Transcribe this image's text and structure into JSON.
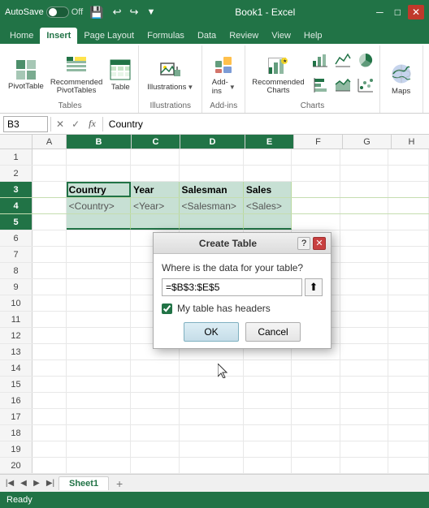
{
  "titleBar": {
    "title": "Book1 - Excel",
    "autoSaveLabel": "AutoSave",
    "autoSaveState": "Off"
  },
  "qat": {
    "buttons": [
      "💾",
      "↩",
      "↪",
      "🖊",
      "▼"
    ]
  },
  "ribbonTabs": [
    "Home",
    "Insert",
    "Page Layout",
    "Formulas",
    "Data",
    "Review",
    "View",
    "Help"
  ],
  "activeTab": "Insert",
  "ribbonGroups": [
    {
      "name": "Tables",
      "items": [
        {
          "id": "pivot-table",
          "icon": "pivot",
          "label": "PivotTable"
        },
        {
          "id": "recommended-pivots",
          "icon": "rec-pivot",
          "label": "Recommended\nPivotTables"
        },
        {
          "id": "table",
          "icon": "table",
          "label": "Table"
        }
      ]
    },
    {
      "name": "Illustrations",
      "items": [
        {
          "id": "illustrations",
          "icon": "illus",
          "label": "Illustrations",
          "hasDropdown": true
        }
      ]
    },
    {
      "name": "Add-ins",
      "items": [
        {
          "id": "add-ins",
          "icon": "addins",
          "label": "Add-\nins",
          "hasDropdown": true
        }
      ]
    },
    {
      "name": "Charts",
      "items": [
        {
          "id": "recommended-charts",
          "icon": "rec-charts",
          "label": "Recommended\nCharts"
        },
        {
          "id": "col-chart",
          "icon": "col",
          "label": ""
        },
        {
          "id": "line-chart",
          "icon": "line",
          "label": ""
        },
        {
          "id": "pie-chart",
          "icon": "pie",
          "label": ""
        },
        {
          "id": "bar-chart",
          "icon": "bar",
          "label": ""
        },
        {
          "id": "area-chart",
          "icon": "area",
          "label": ""
        },
        {
          "id": "scatter-chart",
          "icon": "scatter",
          "label": ""
        },
        {
          "id": "more-charts",
          "icon": "more",
          "label": ""
        }
      ]
    },
    {
      "name": "Maps",
      "items": [
        {
          "id": "maps",
          "icon": "maps",
          "label": "Maps"
        }
      ]
    }
  ],
  "formulaBar": {
    "nameBox": "B3",
    "cancelIcon": "✕",
    "confirmIcon": "✓",
    "functionIcon": "fx",
    "formula": "Country"
  },
  "columns": [
    "A",
    "B",
    "C",
    "D",
    "E",
    "F",
    "G",
    "H"
  ],
  "rows": [
    {
      "num": 1,
      "cells": [
        "",
        "",
        "",
        "",
        "",
        "",
        "",
        ""
      ]
    },
    {
      "num": 2,
      "cells": [
        "",
        "",
        "",
        "",
        "",
        "",
        "",
        ""
      ]
    },
    {
      "num": 3,
      "cells": [
        "",
        "Country",
        "Year",
        "Salesman",
        "Sales",
        "",
        "",
        ""
      ]
    },
    {
      "num": 4,
      "cells": [
        "",
        "<Country>",
        "<Year>",
        "<Salesman>",
        "<Sales>",
        "",
        "",
        ""
      ]
    },
    {
      "num": 5,
      "cells": [
        "",
        "",
        "",
        "",
        "",
        "",
        "",
        ""
      ]
    },
    {
      "num": 6,
      "cells": [
        "",
        "",
        "",
        "",
        "",
        "",
        "",
        ""
      ]
    },
    {
      "num": 7,
      "cells": [
        "",
        "",
        "",
        "",
        "",
        "",
        "",
        ""
      ]
    },
    {
      "num": 8,
      "cells": [
        "",
        "",
        "",
        "",
        "",
        "",
        "",
        ""
      ]
    },
    {
      "num": 9,
      "cells": [
        "",
        "",
        "",
        "",
        "",
        "",
        "",
        ""
      ]
    },
    {
      "num": 10,
      "cells": [
        "",
        "",
        "",
        "",
        "",
        "",
        "",
        ""
      ]
    },
    {
      "num": 11,
      "cells": [
        "",
        "",
        "",
        "",
        "",
        "",
        "",
        ""
      ]
    },
    {
      "num": 12,
      "cells": [
        "",
        "",
        "",
        "",
        "",
        "",
        "",
        ""
      ]
    },
    {
      "num": 13,
      "cells": [
        "",
        "",
        "",
        "",
        "",
        "",
        "",
        ""
      ]
    },
    {
      "num": 14,
      "cells": [
        "",
        "",
        "",
        "",
        "",
        "",
        "",
        ""
      ]
    },
    {
      "num": 15,
      "cells": [
        "",
        "",
        "",
        "",
        "",
        "",
        "",
        ""
      ]
    },
    {
      "num": 16,
      "cells": [
        "",
        "",
        "",
        "",
        "",
        "",
        "",
        ""
      ]
    },
    {
      "num": 17,
      "cells": [
        "",
        "",
        "",
        "",
        "",
        "",
        "",
        ""
      ]
    },
    {
      "num": 18,
      "cells": [
        "",
        "",
        "",
        "",
        "",
        "",
        "",
        ""
      ]
    },
    {
      "num": 19,
      "cells": [
        "",
        "",
        "",
        "",
        "",
        "",
        "",
        ""
      ]
    },
    {
      "num": 20,
      "cells": [
        "",
        "",
        "",
        "",
        "",
        "",
        "",
        ""
      ]
    }
  ],
  "selectedRange": {
    "startRow": 3,
    "endRow": 5,
    "startCol": 1,
    "endCol": 4
  },
  "activeCell": "B3",
  "dialog": {
    "title": "Create Table",
    "helpBtn": "?",
    "closeBtn": "✕",
    "label": "Where is the data for your table?",
    "rangeInput": "=$B$3:$E$5",
    "collapseIcon": "⬆",
    "checkboxChecked": true,
    "checkboxLabel": "My table has headers",
    "okLabel": "OK",
    "cancelLabel": "Cancel"
  },
  "sheetTabs": [
    "Sheet1"
  ],
  "statusBar": {
    "text": "Ready"
  }
}
